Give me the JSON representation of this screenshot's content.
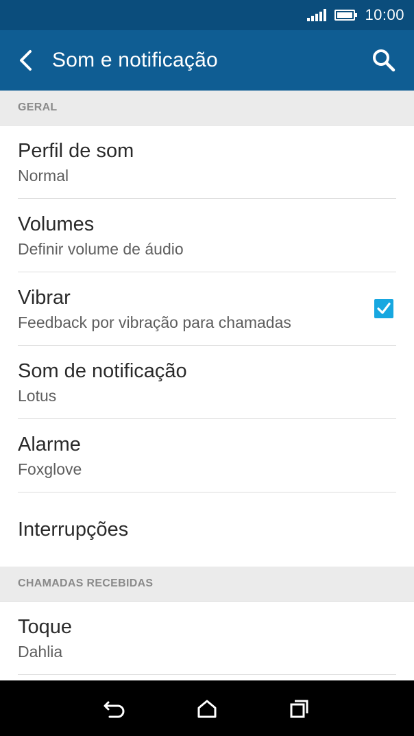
{
  "status_bar": {
    "time": "10:00",
    "icons": [
      "signal-icon",
      "battery-icon"
    ]
  },
  "app_bar": {
    "title": "Som e notificação",
    "back_icon": "back-arrow-icon",
    "search_icon": "search-icon"
  },
  "sections": [
    {
      "header": "GERAL",
      "items": [
        {
          "primary": "Perfil de som",
          "secondary": "Normal"
        },
        {
          "primary": "Volumes",
          "secondary": "Definir volume de áudio"
        },
        {
          "primary": "Vibrar",
          "secondary": "Feedback por vibração para chamadas",
          "checked": true
        },
        {
          "primary": "Som de notificação",
          "secondary": "Lotus"
        },
        {
          "primary": "Alarme",
          "secondary": "Foxglove"
        },
        {
          "primary": "Interrupções"
        }
      ]
    },
    {
      "header": "CHAMADAS RECEBIDAS",
      "items": [
        {
          "primary": "Toque",
          "secondary": "Dahlia"
        }
      ]
    }
  ],
  "nav_bar": {
    "icons": [
      "back-icon",
      "home-icon",
      "recents-icon"
    ]
  },
  "colors": {
    "status_bar": "#0b4d7c",
    "app_bar": "#0f5d93",
    "checkbox": "#17a7e0"
  }
}
